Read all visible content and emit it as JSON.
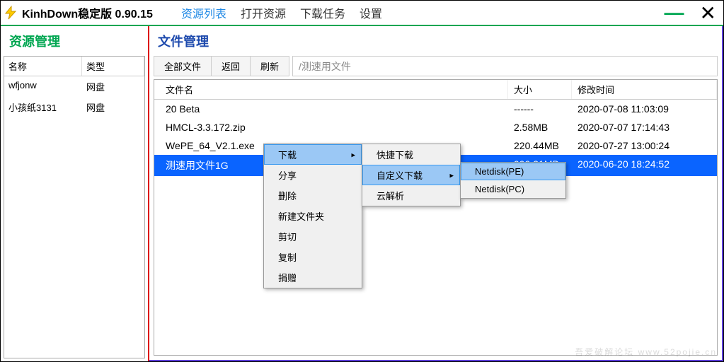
{
  "titlebar": {
    "title": "KinhDown稳定版 0.90.15",
    "menu": [
      "资源列表",
      "打开资源",
      "下载任务",
      "设置"
    ],
    "active_menu": 0
  },
  "sidebar": {
    "title": "资源管理",
    "headers": {
      "name": "名称",
      "type": "类型"
    },
    "rows": [
      {
        "name": "wfjonw",
        "type": "网盘"
      },
      {
        "name": "小孩纸3131",
        "type": "网盘"
      }
    ]
  },
  "main": {
    "title": "文件管理",
    "toolbar": {
      "all": "全部文件",
      "back": "返回",
      "refresh": "刷新",
      "path": "/测速用文件"
    },
    "headers": {
      "name": "文件名",
      "size": "大小",
      "time": "修改时间"
    },
    "rows": [
      {
        "name": "20 Beta",
        "size": "------",
        "time": "2020-07-08 11:03:09",
        "selected": false
      },
      {
        "name": "HMCL-3.3.172.zip",
        "size": "2.58MB",
        "time": "2020-07-07 17:14:43",
        "selected": false
      },
      {
        "name": "WePE_64_V2.1.exe",
        "size": "220.44MB",
        "time": "2020-07-27 13:00:24",
        "selected": false
      },
      {
        "name": "测速用文件1G",
        "size": "999.31MB",
        "time": "2020-06-20 18:24:52",
        "selected": true
      }
    ]
  },
  "context_menu": {
    "level1": [
      {
        "label": "下载",
        "highlight": true,
        "has_sub": true
      },
      {
        "label": "分享"
      },
      {
        "label": "删除"
      },
      {
        "label": "新建文件夹"
      },
      {
        "label": "剪切"
      },
      {
        "label": "复制"
      },
      {
        "label": "捐赠"
      }
    ],
    "level2": [
      {
        "label": "快捷下载"
      },
      {
        "label": "自定义下载",
        "highlight": true,
        "has_sub": true
      },
      {
        "label": "云解析"
      }
    ],
    "level3": [
      {
        "label": "Netdisk(PE)",
        "highlight": true
      },
      {
        "label": "Netdisk(PC)"
      }
    ]
  },
  "watermark": "吾爱破解论坛 www.52pojie.cn"
}
